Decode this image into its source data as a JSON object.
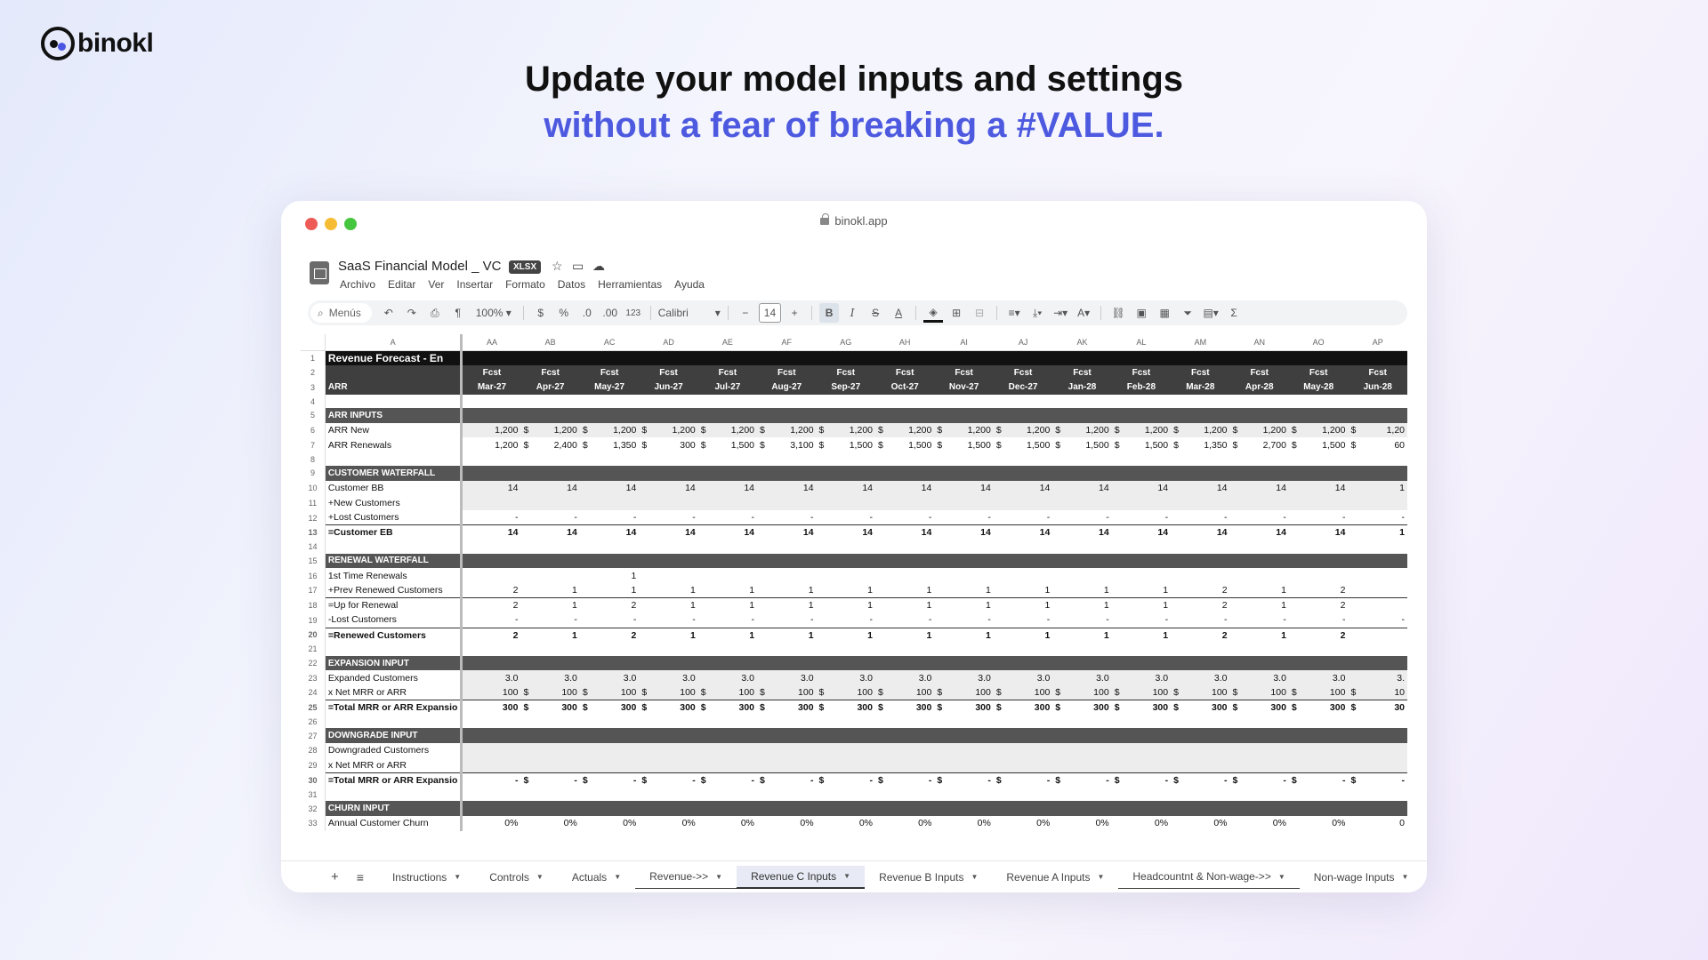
{
  "brand": {
    "name": "binokl"
  },
  "headline": {
    "line1": "Update your model inputs and settings",
    "line2": "without a fear of breaking a #VALUE."
  },
  "browser": {
    "url": "binokl.app"
  },
  "doc": {
    "title": "SaaS Financial Model _ VC",
    "badge": "XLSX",
    "menu": [
      "Archivo",
      "Editar",
      "Ver",
      "Insertar",
      "Formato",
      "Datos",
      "Herramientas",
      "Ayuda"
    ]
  },
  "toolbar": {
    "search_placeholder": "Menús",
    "zoom": "100%",
    "currency": "$",
    "percent": "%",
    "dec_minus": ".0",
    "dec_plus": ".00",
    "num_format": "123",
    "font": "Calibri",
    "font_size": "14"
  },
  "sheet": {
    "col_a": "A",
    "columns": [
      "AA",
      "AB",
      "AC",
      "AD",
      "AE",
      "AF",
      "AG",
      "AH",
      "AI",
      "AJ",
      "AK",
      "AL",
      "AM",
      "AN",
      "AO",
      "AP"
    ],
    "title_row": "Revenue Forecast - En",
    "fcst": "Fcst",
    "months": [
      "Mar-27",
      "Apr-27",
      "May-27",
      "Jun-27",
      "Jul-27",
      "Aug-27",
      "Sep-27",
      "Oct-27",
      "Nov-27",
      "Dec-27",
      "Jan-28",
      "Feb-28",
      "Mar-28",
      "Apr-28",
      "May-28",
      "Jun-28"
    ],
    "arr_label": "ARR",
    "sections": {
      "arr_inputs": "ARR INPUTS",
      "customer_waterfall": "CUSTOMER WATERFALL",
      "renewal_waterfall": "RENEWAL WATERFALL",
      "expansion_input": "EXPANSION INPUT",
      "downgrade_input": "DOWNGRADE INPUT",
      "churn_input": "CHURN INPUT"
    },
    "rows": {
      "arr_new": {
        "label": "ARR New",
        "values": [
          "1,200",
          "1,200",
          "1,200",
          "1,200",
          "1,200",
          "1,200",
          "1,200",
          "1,200",
          "1,200",
          "1,200",
          "1,200",
          "1,200",
          "1,200",
          "1,200",
          "1,200",
          "1,20"
        ]
      },
      "arr_renewals": {
        "label": "ARR Renewals",
        "values": [
          "1,200",
          "2,400",
          "1,350",
          "300",
          "1,500",
          "3,100",
          "1,500",
          "1,500",
          "1,500",
          "1,500",
          "1,500",
          "1,500",
          "1,350",
          "2,700",
          "1,500",
          "60"
        ]
      },
      "customer_bb": {
        "label": "Customer BB",
        "values": [
          "14",
          "14",
          "14",
          "14",
          "14",
          "14",
          "14",
          "14",
          "14",
          "14",
          "14",
          "14",
          "14",
          "14",
          "14",
          "1"
        ]
      },
      "new_customers": {
        "label": "+New Customers"
      },
      "lost_customers": {
        "label": "+Lost Customers",
        "dash": "-"
      },
      "customer_eb": {
        "label": "=Customer EB",
        "values": [
          "14",
          "14",
          "14",
          "14",
          "14",
          "14",
          "14",
          "14",
          "14",
          "14",
          "14",
          "14",
          "14",
          "14",
          "14",
          "1"
        ]
      },
      "first_time": {
        "label": "1st Time Renewals",
        "values": [
          "",
          "",
          "1",
          "",
          "",
          "",
          "",
          "",
          "",
          "",
          "",
          "",
          "",
          "",
          "",
          ""
        ]
      },
      "prev_renewed": {
        "label": "+Prev Renewed Customers",
        "values": [
          "2",
          "1",
          "1",
          "1",
          "1",
          "1",
          "1",
          "1",
          "1",
          "1",
          "1",
          "1",
          "2",
          "1",
          "2",
          ""
        ]
      },
      "up_for_renewal": {
        "label": "=Up for Renewal",
        "values": [
          "2",
          "1",
          "2",
          "1",
          "1",
          "1",
          "1",
          "1",
          "1",
          "1",
          "1",
          "1",
          "2",
          "1",
          "2",
          ""
        ]
      },
      "lost_customers2": {
        "label": "-Lost Customers"
      },
      "renewed": {
        "label": "=Renewed Customers",
        "values": [
          "2",
          "1",
          "2",
          "1",
          "1",
          "1",
          "1",
          "1",
          "1",
          "1",
          "1",
          "1",
          "2",
          "1",
          "2",
          ""
        ]
      },
      "expanded": {
        "label": "Expanded Customers",
        "values": [
          "3.0",
          "3.0",
          "3.0",
          "3.0",
          "3.0",
          "3.0",
          "3.0",
          "3.0",
          "3.0",
          "3.0",
          "3.0",
          "3.0",
          "3.0",
          "3.0",
          "3.0",
          "3."
        ]
      },
      "net_mrr": {
        "label": "x Net MRR or ARR",
        "values": [
          "100",
          "100",
          "100",
          "100",
          "100",
          "100",
          "100",
          "100",
          "100",
          "100",
          "100",
          "100",
          "100",
          "100",
          "100",
          "10"
        ]
      },
      "total_expansion": {
        "label": "=Total MRR or ARR Expansio",
        "values": [
          "300",
          "300",
          "300",
          "300",
          "300",
          "300",
          "300",
          "300",
          "300",
          "300",
          "300",
          "300",
          "300",
          "300",
          "300",
          "30"
        ]
      },
      "downgraded": {
        "label": "Downgraded Customers"
      },
      "net_mrr2": {
        "label": "x Net MRR or ARR"
      },
      "total_downgrade": {
        "label": "=Total MRR or ARR Expansio",
        "dash": "-"
      },
      "churn": {
        "label": "Annual Customer Churn",
        "values": [
          "0%",
          "0%",
          "0%",
          "0%",
          "0%",
          "0%",
          "0%",
          "0%",
          "0%",
          "0%",
          "0%",
          "0%",
          "0%",
          "0%",
          "0%",
          "0"
        ]
      }
    }
  },
  "tabs": [
    "Instructions",
    "Controls",
    "Actuals",
    "Revenue->>",
    "Revenue C Inputs",
    "Revenue B Inputs",
    "Revenue A Inputs",
    "Headcountnt & Non-wage->>",
    "Non-wage Inputs"
  ],
  "active_tab": "Revenue C Inputs"
}
